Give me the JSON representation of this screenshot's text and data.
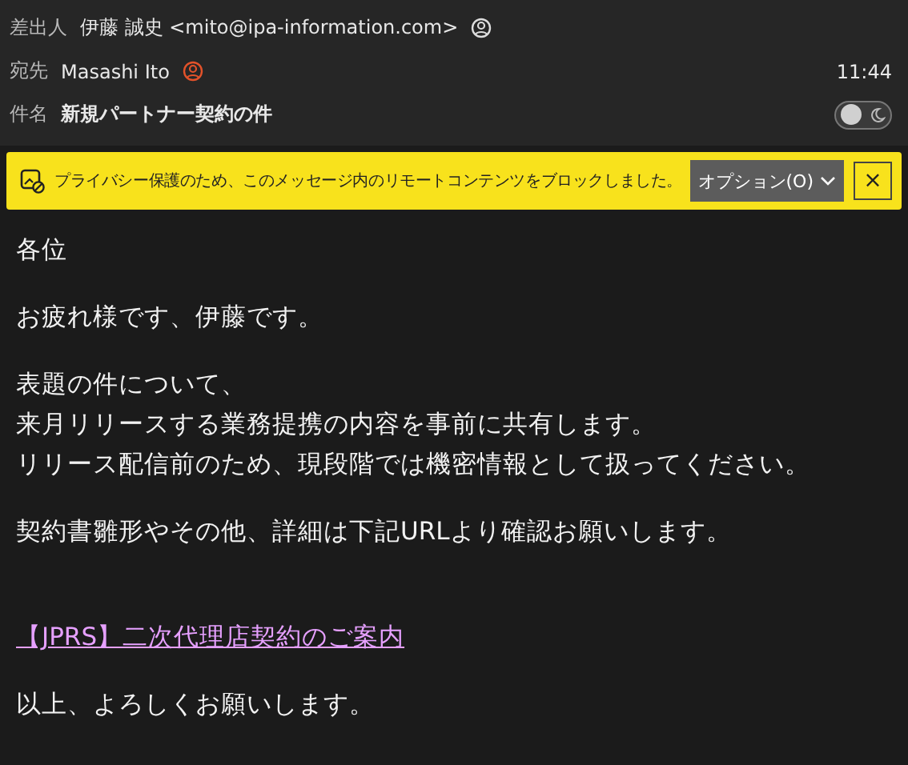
{
  "header": {
    "from": {
      "label": "差出人",
      "value": "伊藤 誠史 <mito@ipa-information.com>"
    },
    "to": {
      "label": "宛先",
      "value": "Masashi Ito"
    },
    "time": "11:44",
    "subject": {
      "label": "件名",
      "value": "新規パートナー契約の件"
    },
    "dark_mode_toggle": {
      "on": false
    }
  },
  "banner": {
    "message": "プライバシー保護のため、このメッセージ内のリモートコンテンツをブロックしました。",
    "options_button": "オプション(O)",
    "close_button": "×"
  },
  "body": [
    {
      "kind": "text",
      "lines": [
        "各位"
      ]
    },
    {
      "kind": "text",
      "lines": [
        "お疲れ様です、伊藤です。"
      ]
    },
    {
      "kind": "text",
      "lines": [
        "表題の件について、",
        "来月リリースする業務提携の内容を事前に共有します。",
        "リリース配信前のため、現段階では機密情報として扱ってください。"
      ]
    },
    {
      "kind": "text",
      "lines": [
        "契約書雛形やその他、詳細は下記URLより確認お願いします。"
      ]
    },
    {
      "kind": "link",
      "lines": [
        "【JPRS】二次代理店契約のご案内"
      ]
    },
    {
      "kind": "text",
      "lines": [
        "以上、よろしくお願いします。"
      ]
    }
  ]
}
